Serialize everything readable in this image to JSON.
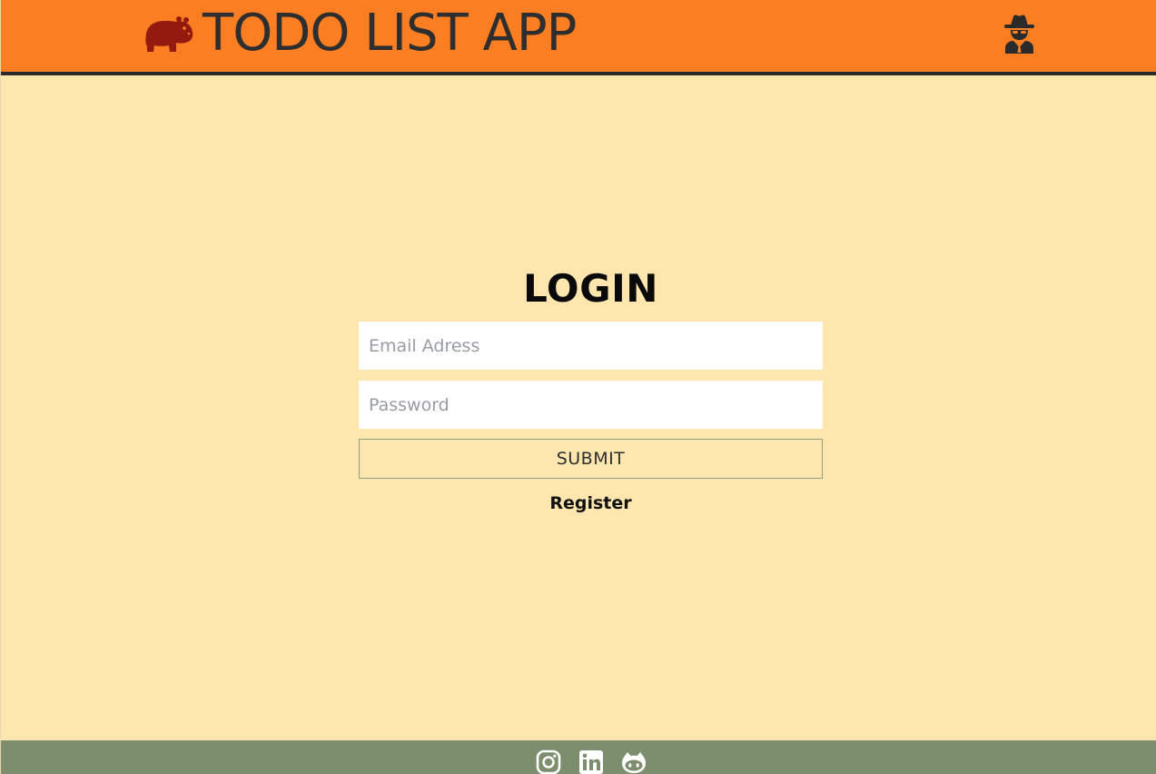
{
  "header": {
    "title": "TODO LIST APP",
    "logo_icon": "hippo-icon",
    "user_icon": "user-secret-icon",
    "background": "#fc7e22",
    "logo_color": "#931a0e"
  },
  "login": {
    "title": "LOGIN",
    "email_placeholder": "Email Adress",
    "password_placeholder": "Password",
    "submit_label": "SUBMIT",
    "register_label": "Register"
  },
  "footer": {
    "background": "#7c8e6e",
    "links": [
      "instagram-icon",
      "linkedin-icon",
      "github-icon"
    ]
  },
  "colors": {
    "page_background": "#fee6ae",
    "accent": "#fc7e22"
  }
}
